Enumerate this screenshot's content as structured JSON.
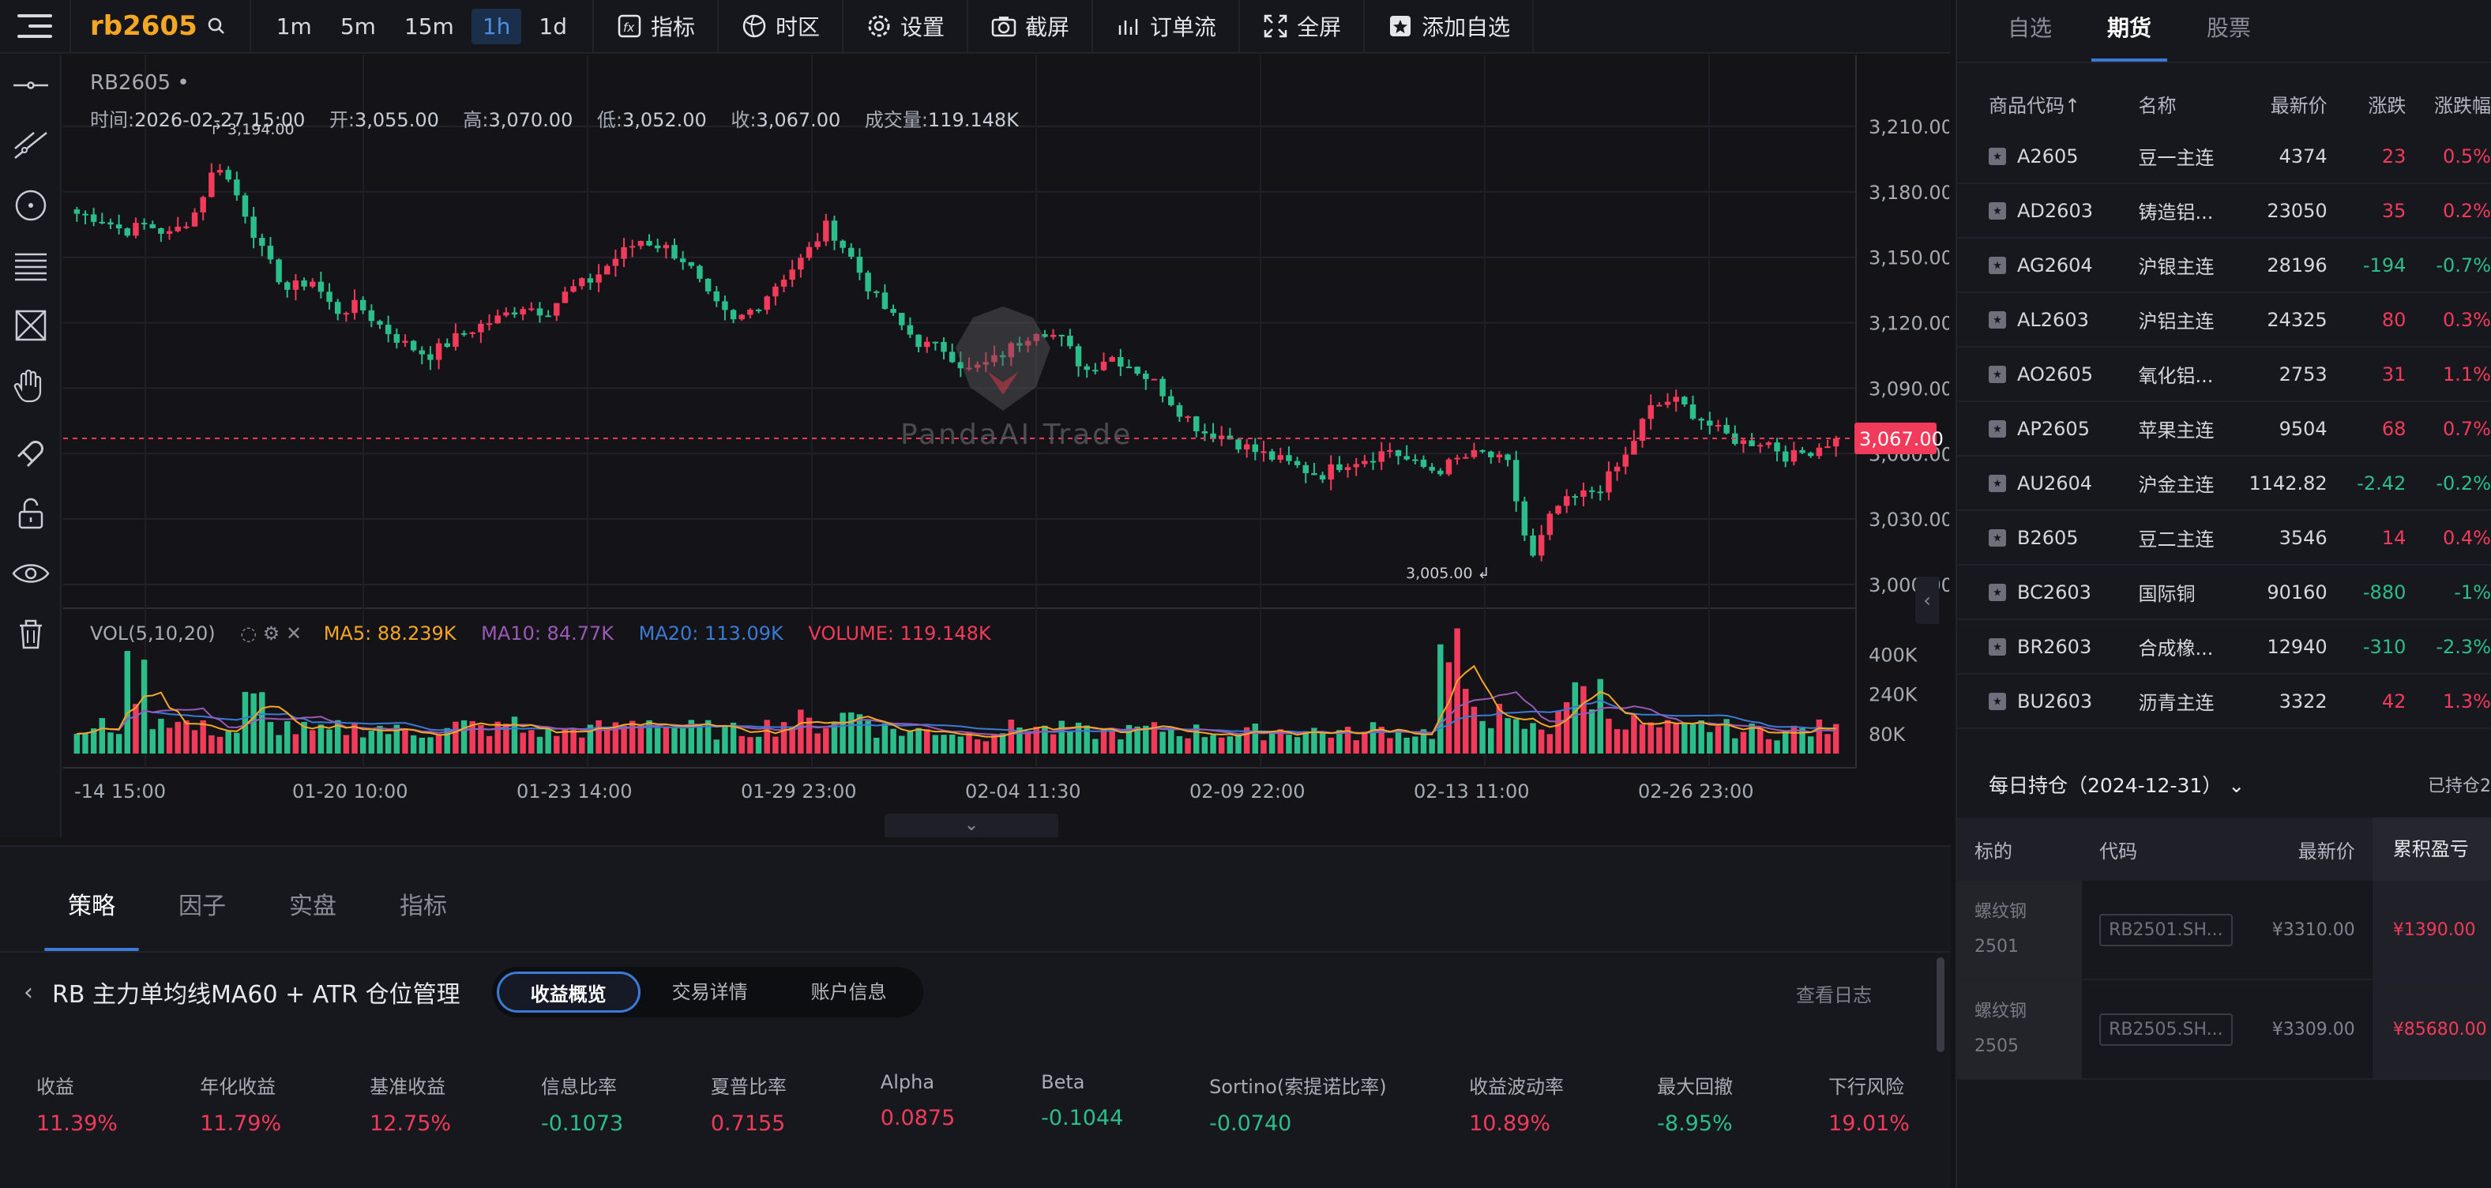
{
  "topbar": {
    "symbol": "rb2605",
    "periods": [
      "1m",
      "5m",
      "15m",
      "1h",
      "1d"
    ],
    "active_period": "1h",
    "tools": [
      {
        "label": "指标",
        "icon": "fx-icon"
      },
      {
        "label": "时区",
        "icon": "globe-icon"
      },
      {
        "label": "设置",
        "icon": "gear-icon"
      },
      {
        "label": "截屏",
        "icon": "camera-icon"
      },
      {
        "label": "订单流",
        "icon": "order-flow-icon"
      },
      {
        "label": "全屏",
        "icon": "fullscreen-icon"
      },
      {
        "label": "添加自选",
        "icon": "bookmark-add-icon"
      }
    ]
  },
  "chart": {
    "symbol_label": "RB2605",
    "ohlc": {
      "time_label": "时间:",
      "time": "2026-02-27 15:00",
      "open_label": "开:",
      "open": "3,055.00",
      "high_label": "高:",
      "high": "3,070.00",
      "low_label": "低:",
      "low": "3,052.00",
      "close_label": "收:",
      "close": "3,067.00",
      "vol_label": "成交量:",
      "vol": "119.148K"
    },
    "watermark": "PandaAI Trade",
    "max_label": "3,194.00",
    "min_label": "3,005.00",
    "current_price": "3,067.00",
    "current_price_value": 3067,
    "price_ticks": [
      "3,210.00",
      "3,180.00",
      "3,150.00",
      "3,120.00",
      "3,090.00",
      "3,060.00",
      "3,030.00",
      "3,000.00"
    ],
    "price_tick_values": [
      3210,
      3180,
      3150,
      3120,
      3090,
      3060,
      3030,
      3000
    ],
    "vol_legend": {
      "label": "VOL(5,10,20)",
      "ma5": "MA5: 88.239K",
      "ma10": "MA10: 84.77K",
      "ma20": "MA20: 113.09K",
      "volume": "VOLUME: 119.148K"
    },
    "vol_ticks": [
      "400K",
      "240K",
      "80K"
    ],
    "time_ticks": [
      "-14 15:00",
      "01-20 10:00",
      "01-23 14:00",
      "01-29 23:00",
      "02-04 11:30",
      "02-09 22:00",
      "02-13 11:00",
      "02-26 23:00"
    ],
    "colors": {
      "up": "#f23a5a",
      "down": "#2bbd8a",
      "ma5": "#f5a623",
      "ma10": "#9b59b6",
      "ma20": "#3a7bd5"
    },
    "close_path": [
      3170,
      3168,
      3162,
      3165,
      3160,
      3170,
      3194,
      3175,
      3150,
      3135,
      3140,
      3125,
      3128,
      3118,
      3110,
      3105,
      3112,
      3118,
      3122,
      3128,
      3125,
      3135,
      3140,
      3150,
      3158,
      3155,
      3148,
      3130,
      3120,
      3128,
      3140,
      3150,
      3165,
      3150,
      3132,
      3120,
      3110,
      3108,
      3098,
      3102,
      3110,
      3118,
      3112,
      3098,
      3105,
      3100,
      3092,
      3080,
      3070,
      3068,
      3062,
      3058,
      3054,
      3050,
      3056,
      3058,
      3062,
      3055,
      3052,
      3058,
      3060,
      3055,
      3010,
      3035,
      3040,
      3045,
      3058,
      3080,
      3085,
      3078,
      3070,
      3065,
      3066,
      3058,
      3062,
      3067
    ],
    "volumes": [
      90,
      110,
      300,
      150,
      120,
      100,
      90,
      200,
      110,
      95,
      85,
      100,
      105,
      90,
      88,
      92,
      110,
      100,
      120,
      90,
      85,
      95,
      100,
      120,
      140,
      110,
      100,
      90,
      95,
      110,
      130,
      120,
      150,
      160,
      100,
      90,
      95,
      85,
      80,
      100,
      110,
      95,
      90,
      85,
      88,
      95,
      100,
      90,
      85,
      80,
      88,
      95,
      92,
      85,
      80,
      100,
      90,
      85,
      370,
      200,
      150,
      110,
      100,
      220,
      250,
      160,
      120,
      100,
      95,
      110,
      100,
      90,
      88,
      92,
      100,
      119
    ]
  },
  "bottom": {
    "tabs": [
      "策略",
      "因子",
      "实盘",
      "指标"
    ],
    "active_tab": "策略",
    "strategy_title": "RB 主力单均线MA60 + ATR 仓位管理",
    "segments": [
      "收益概览",
      "交易详情",
      "账户信息"
    ],
    "active_segment": "收益概览",
    "view_log": "查看日志",
    "metrics": [
      {
        "label": "收益",
        "value": "11.39%",
        "color": "red"
      },
      {
        "label": "年化收益",
        "value": "11.79%",
        "color": "red"
      },
      {
        "label": "基准收益",
        "value": "12.75%",
        "color": "red"
      },
      {
        "label": "信息比率",
        "value": "-0.1073",
        "color": "green"
      },
      {
        "label": "夏普比率",
        "value": "0.7155",
        "color": "red"
      },
      {
        "label": "Alpha",
        "value": "0.0875",
        "color": "red"
      },
      {
        "label": "Beta",
        "value": "-0.1044",
        "color": "green"
      },
      {
        "label": "Sortino(索提诺比率)",
        "value": "-0.0740",
        "color": "green"
      },
      {
        "label": "收益波动率",
        "value": "10.89%",
        "color": "red"
      },
      {
        "label": "最大回撤",
        "value": "-8.95%",
        "color": "green"
      },
      {
        "label": "下行风险",
        "value": "19.01%",
        "color": "red"
      }
    ]
  },
  "right": {
    "tabs": [
      "自选",
      "期货",
      "股票"
    ],
    "active_tab": "期货",
    "headers": [
      "商品代码↑",
      "名称",
      "最新价",
      "涨跌",
      "涨跌幅"
    ],
    "rows": [
      {
        "code": "A2605",
        "name": "豆一主连",
        "price": "4374",
        "chg": "23",
        "pct": "0.5%",
        "dir": "red"
      },
      {
        "code": "AD2603",
        "name": "铸造铝...",
        "price": "23050",
        "chg": "35",
        "pct": "0.2%",
        "dir": "red"
      },
      {
        "code": "AG2604",
        "name": "沪银主连",
        "price": "28196",
        "chg": "-194",
        "pct": "-0.7%",
        "dir": "green"
      },
      {
        "code": "AL2603",
        "name": "沪铝主连",
        "price": "24325",
        "chg": "80",
        "pct": "0.3%",
        "dir": "red"
      },
      {
        "code": "AO2605",
        "name": "氧化铝...",
        "price": "2753",
        "chg": "31",
        "pct": "1.1%",
        "dir": "red"
      },
      {
        "code": "AP2605",
        "name": "苹果主连",
        "price": "9504",
        "chg": "68",
        "pct": "0.7%",
        "dir": "red"
      },
      {
        "code": "AU2604",
        "name": "沪金主连",
        "price": "1142.82",
        "chg": "-2.42",
        "pct": "-0.2%",
        "dir": "green"
      },
      {
        "code": "B2605",
        "name": "豆二主连",
        "price": "3546",
        "chg": "14",
        "pct": "0.4%",
        "dir": "red"
      },
      {
        "code": "BC2603",
        "name": "国际铜",
        "price": "90160",
        "chg": "-880",
        "pct": "-1%",
        "dir": "green"
      },
      {
        "code": "BR2603",
        "name": "合成橡...",
        "price": "12940",
        "chg": "-310",
        "pct": "-2.3%",
        "dir": "green"
      },
      {
        "code": "BU2603",
        "name": "沥青主连",
        "price": "3322",
        "chg": "42",
        "pct": "1.3%",
        "dir": "red"
      }
    ],
    "holdings": {
      "title": "每日持仓（2024-12-31）",
      "right": "已持仓2",
      "headers": [
        "标的",
        "代码",
        "最新价",
        "累积盈亏"
      ],
      "rows": [
        {
          "name": "螺纹钢",
          "sub": "2501",
          "code": "RB2501.SH...",
          "price": "¥3310.00",
          "pnl": "¥1390.00"
        },
        {
          "name": "螺纹钢",
          "sub": "2505",
          "code": "RB2505.SH...",
          "price": "¥3309.00",
          "pnl": "¥85680.00"
        }
      ]
    }
  }
}
